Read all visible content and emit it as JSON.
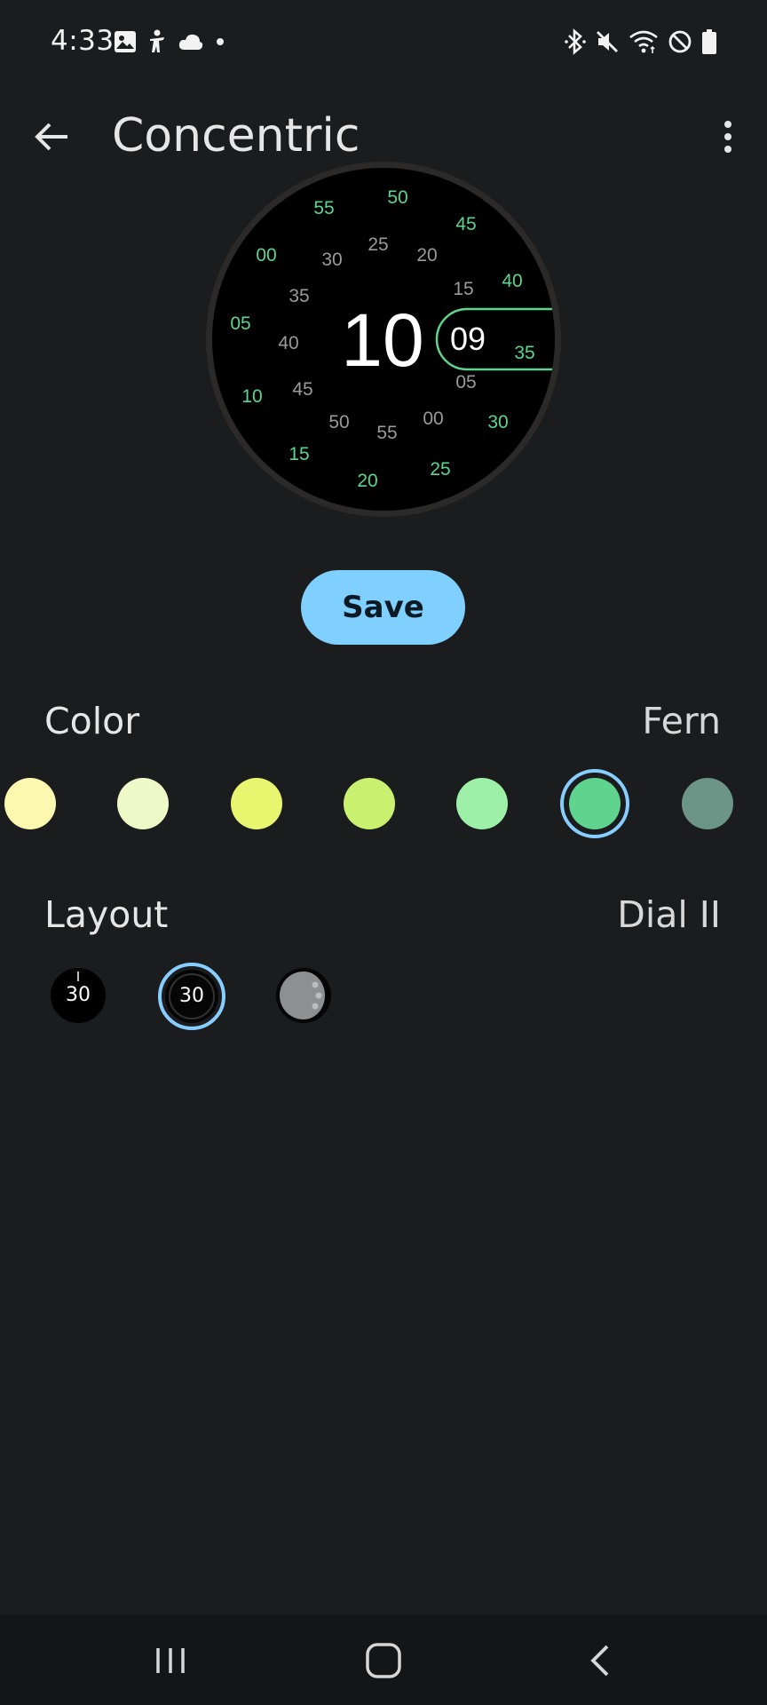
{
  "status_bar": {
    "time": "4:33",
    "left_icons": [
      "image-icon",
      "accessibility-icon",
      "cloud-icon",
      "dot-icon"
    ],
    "right_icons": [
      "bluetooth-icon",
      "mute-icon",
      "wifi-icon",
      "do-not-disturb-icon",
      "battery-icon"
    ]
  },
  "app_bar": {
    "title": "Concentric",
    "back_icon": "arrow-back-icon",
    "menu_icon": "more-vert-icon"
  },
  "preview": {
    "hour": "10",
    "minute": "09",
    "accent_color": "#5ed48f",
    "outer_ring": [
      "50",
      "45",
      "40",
      "35",
      "30",
      "25",
      "20",
      "15",
      "10",
      "05",
      "00",
      "55"
    ],
    "inner_ring": [
      "25",
      "20",
      "15",
      "05",
      "00",
      "55",
      "50",
      "45",
      "40",
      "35",
      "30"
    ]
  },
  "save": {
    "label": "Save"
  },
  "color_section": {
    "label": "Color",
    "selected_name": "Fern",
    "swatches": [
      {
        "color": "#fdf8b0",
        "selected": false
      },
      {
        "color": "#eef9c8",
        "selected": false
      },
      {
        "color": "#e8f56e",
        "selected": false
      },
      {
        "color": "#c9f06e",
        "selected": false
      },
      {
        "color": "#9ef0a8",
        "selected": false
      },
      {
        "color": "#5ed48f",
        "selected": true
      },
      {
        "color": "#6c9487",
        "selected": false
      }
    ]
  },
  "layout_section": {
    "label": "Layout",
    "selected_name": "Dial II",
    "options": [
      {
        "label": "30",
        "selected": false
      },
      {
        "label": "30",
        "selected": true
      },
      {
        "label": "",
        "selected": false
      }
    ]
  },
  "nav_bar": {
    "recents_icon": "recents-icon",
    "home_icon": "home-icon",
    "back_icon": "nav-back-icon"
  }
}
